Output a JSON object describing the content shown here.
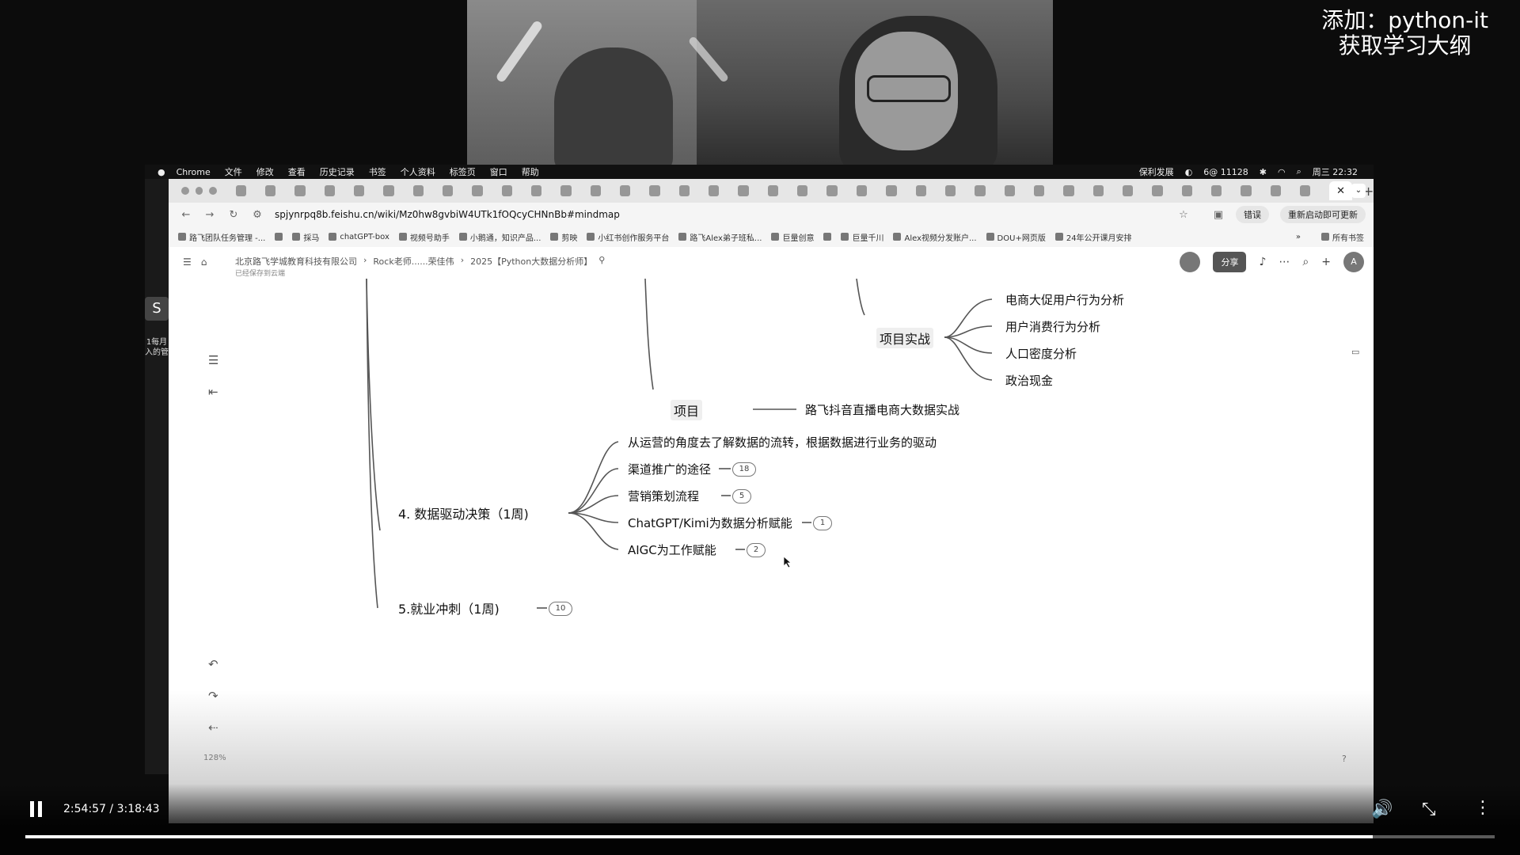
{
  "watermark": {
    "line1": "添加：python-it",
    "line2": "获取学习大纲"
  },
  "left_strip": {
    "thumb": "S",
    "caption": "1每月入的管"
  },
  "menubar": {
    "items": [
      "Chrome",
      "文件",
      "修改",
      "查看",
      "历史记录",
      "书签",
      "个人资料",
      "标签页",
      "窗口",
      "帮助"
    ],
    "right_text": [
      "保利发展",
      "6@ 11128"
    ],
    "clock": "周三 22:32"
  },
  "browser": {
    "active_tab_close": "✕",
    "url": "spjynrpq8b.feishu.cn/wiki/Mz0hw8gvbiW4UTk1fOQcyCHNnBb#mindmap",
    "error_pill": "错误",
    "update_pill": "重新启动即可更新",
    "bookmarks": [
      "路飞团队任务管理 -...",
      "採马",
      "chatGPT-box",
      "视频号助手",
      "小鹅通，知识产品...",
      "剪映",
      "小红书创作服务平台",
      "路飞Alex弟子班私...",
      "巨量创意",
      "巨量千川",
      "Alex视频分发账户...",
      "DOU+网页版",
      "24年公开课月安排"
    ],
    "all_bookmarks": "所有书签"
  },
  "doc": {
    "breadcrumb": [
      "北京路飞学城教育科技有限公司",
      "Rock老师......荣佳伟",
      "2025【Python大数据分析师】"
    ],
    "saved": "已经保存到云端",
    "share_label": "分享",
    "user_initial": "A"
  },
  "mindmap": {
    "project_practice": "项目实战",
    "practice_children": [
      "电商大促用户行为分析",
      "用户消费行为分析",
      "人口密度分析",
      "政治现金"
    ],
    "project": "项目",
    "project_child": "路飞抖音直播电商大数据实战",
    "section4": "4. 数据驱动决策（1周)",
    "section4_children": [
      {
        "label": "从运营的角度去了解数据的流转，根据数据进行业务的驱动",
        "badge": ""
      },
      {
        "label": "渠道推广的途径",
        "badge": "18"
      },
      {
        "label": "营销策划流程",
        "badge": "5"
      },
      {
        "label": "ChatGPT/Kimi为数据分析赋能",
        "badge": "1"
      },
      {
        "label": "AIGC为工作赋能",
        "badge": "2"
      }
    ],
    "section5": "5.就业冲刺（1周)",
    "section5_badge": "10",
    "zoom": "128%"
  },
  "player": {
    "time": "2:54:57 / 3:18:43",
    "progress": 0.917
  }
}
